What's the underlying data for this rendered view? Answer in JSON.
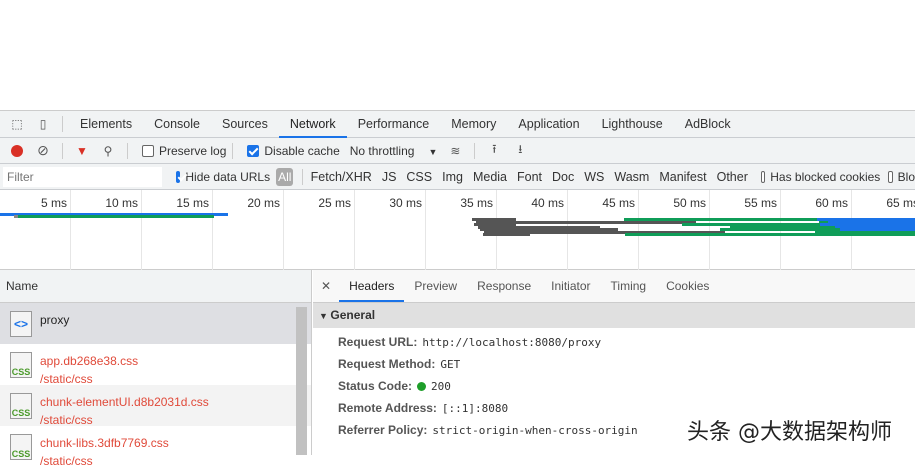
{
  "tabs": [
    "Elements",
    "Console",
    "Sources",
    "Network",
    "Performance",
    "Memory",
    "Application",
    "Lighthouse",
    "AdBlock"
  ],
  "toolbar": {
    "preserve_log": "Preserve log",
    "disable_cache": "Disable cache",
    "throttling": "No throttling"
  },
  "filter": {
    "placeholder": "Filter",
    "hide_data_urls": "Hide data URLs",
    "types": [
      "All",
      "Fetch/XHR",
      "JS",
      "CSS",
      "Img",
      "Media",
      "Font",
      "Doc",
      "WS",
      "Wasm",
      "Manifest",
      "Other"
    ],
    "has_blocked_cookies": "Has blocked cookies",
    "blocked": "Blo"
  },
  "timeline": {
    "ticks": [
      "5 ms",
      "10 ms",
      "15 ms",
      "20 ms",
      "25 ms",
      "30 ms",
      "35 ms",
      "40 ms",
      "45 ms",
      "50 ms",
      "55 ms",
      "60 ms",
      "65 ms"
    ]
  },
  "list": {
    "header": "Name",
    "items": [
      {
        "name": "proxy",
        "path": "",
        "type": "doc"
      },
      {
        "name": "app.db268e38.css",
        "path": "/static/css",
        "type": "css"
      },
      {
        "name": "chunk-elementUI.d8b2031d.css",
        "path": "/static/css",
        "type": "css"
      },
      {
        "name": "chunk-libs.3dfb7769.css",
        "path": "/static/css",
        "type": "css"
      }
    ]
  },
  "details": {
    "tabs": [
      "Headers",
      "Preview",
      "Response",
      "Initiator",
      "Timing",
      "Cookies"
    ],
    "section": "General",
    "rows": [
      {
        "k": "Request URL:",
        "v": "http://localhost:8080/proxy"
      },
      {
        "k": "Request Method:",
        "v": "GET"
      },
      {
        "k": "Status Code:",
        "v": "200"
      },
      {
        "k": "Remote Address:",
        "v": "[::1]:8080"
      },
      {
        "k": "Referrer Policy:",
        "v": "strict-origin-when-cross-origin"
      }
    ]
  },
  "watermark": "头条 @大数据架构师"
}
